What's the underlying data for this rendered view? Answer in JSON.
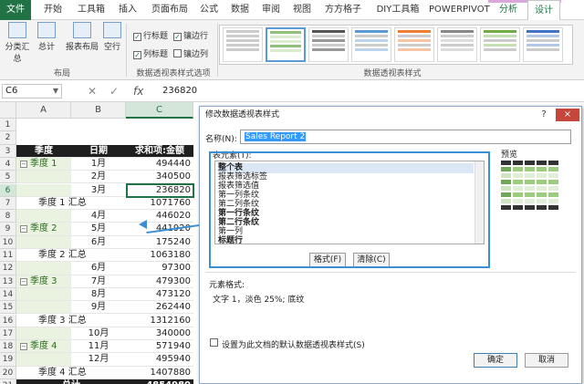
{
  "ribbon_tabs": [
    "文件",
    "开始",
    "工具箱",
    "插入",
    "页面布局",
    "公式",
    "数据",
    "审阅",
    "视图",
    "方方格子",
    "DIY工具箱",
    "POWERPIVOT",
    "分析",
    "设计"
  ],
  "ribbon": {
    "layout_buttons": [
      "分类汇总",
      "总计",
      "报表布局",
      "空行"
    ],
    "layout_group_label": "布局",
    "options_checkboxes": [
      {
        "label": "行标题",
        "checked": true
      },
      {
        "label": "镶边行",
        "checked": true
      },
      {
        "label": "列标题",
        "checked": true
      },
      {
        "label": "镶边列",
        "checked": false
      }
    ],
    "options_group_label": "数据透视表样式选项",
    "styles_group_label": "数据透视表样式"
  },
  "formula_bar": {
    "name_box": "C6",
    "value": "236820"
  },
  "grid": {
    "columns": [
      "A",
      "B",
      "C"
    ],
    "row_numbers": [
      "1",
      "2",
      "3",
      "4",
      "5",
      "6",
      "7",
      "8",
      "9",
      "10",
      "11",
      "12",
      "13",
      "14",
      "15",
      "16",
      "17",
      "18",
      "19",
      "20",
      "21"
    ],
    "header_row": {
      "season": "季度",
      "date": "日期",
      "sum": "求和项:金额"
    },
    "rows": [
      {
        "a": "季度 1",
        "b": "1月",
        "c": "494440",
        "grp": true
      },
      {
        "a": "",
        "b": "2月",
        "c": "340500"
      },
      {
        "a": "",
        "b": "3月",
        "c": "236820"
      },
      {
        "a": "季度 1 汇总",
        "b": "",
        "c": "1071760",
        "sub": true
      },
      {
        "a": "",
        "b": "4月",
        "c": "446020"
      },
      {
        "a": "季度 2",
        "b": "5月",
        "c": "441920",
        "grp": true
      },
      {
        "a": "",
        "b": "6月",
        "c": "175240"
      },
      {
        "a": "季度 2 汇总",
        "b": "",
        "c": "1063180",
        "sub": true
      },
      {
        "a": "",
        "b": "6月",
        "c": "97300"
      },
      {
        "a": "季度 3",
        "b": "7月",
        "c": "479300",
        "grp": true
      },
      {
        "a": "",
        "b": "8月",
        "c": "473120"
      },
      {
        "a": "",
        "b": "9月",
        "c": "262440"
      },
      {
        "a": "季度 3 汇总",
        "b": "",
        "c": "1312160",
        "sub": true
      },
      {
        "a": "",
        "b": "10月",
        "c": "340000"
      },
      {
        "a": "季度 4",
        "b": "11月",
        "c": "571940",
        "grp": true
      },
      {
        "a": "",
        "b": "12月",
        "c": "495940"
      },
      {
        "a": "季度 4 汇总",
        "b": "",
        "c": "1407880",
        "sub": true
      }
    ],
    "total": {
      "label": "总计",
      "value": "4854980"
    }
  },
  "dialog": {
    "title": "修改数据透视表样式",
    "help": "?",
    "close": "×",
    "name_label": "名称(N):",
    "name_value": "Sales Report 2",
    "element_label": "表元素(T):",
    "elements": [
      "整个表",
      "报表筛选标签",
      "报表筛选值",
      "第一列条纹",
      "第二列条纹",
      "第一行条纹",
      "第二行条纹",
      "第一列",
      "标题行"
    ],
    "format_button": "格式(F)",
    "clear_button": "清除(C)",
    "preview_label": "预览",
    "element_format_label": "元素格式:",
    "element_format_value": "文字 1，淡色 25%; 底纹",
    "default_checkbox_label": "设置为此文档的默认数据透视表样式(S)",
    "ok_button": "确定",
    "cancel_button": "取消"
  },
  "colors": {
    "excel_green": "#217346",
    "selection_blue": "#3b8fd4",
    "group_fill": "#e9f3df"
  }
}
